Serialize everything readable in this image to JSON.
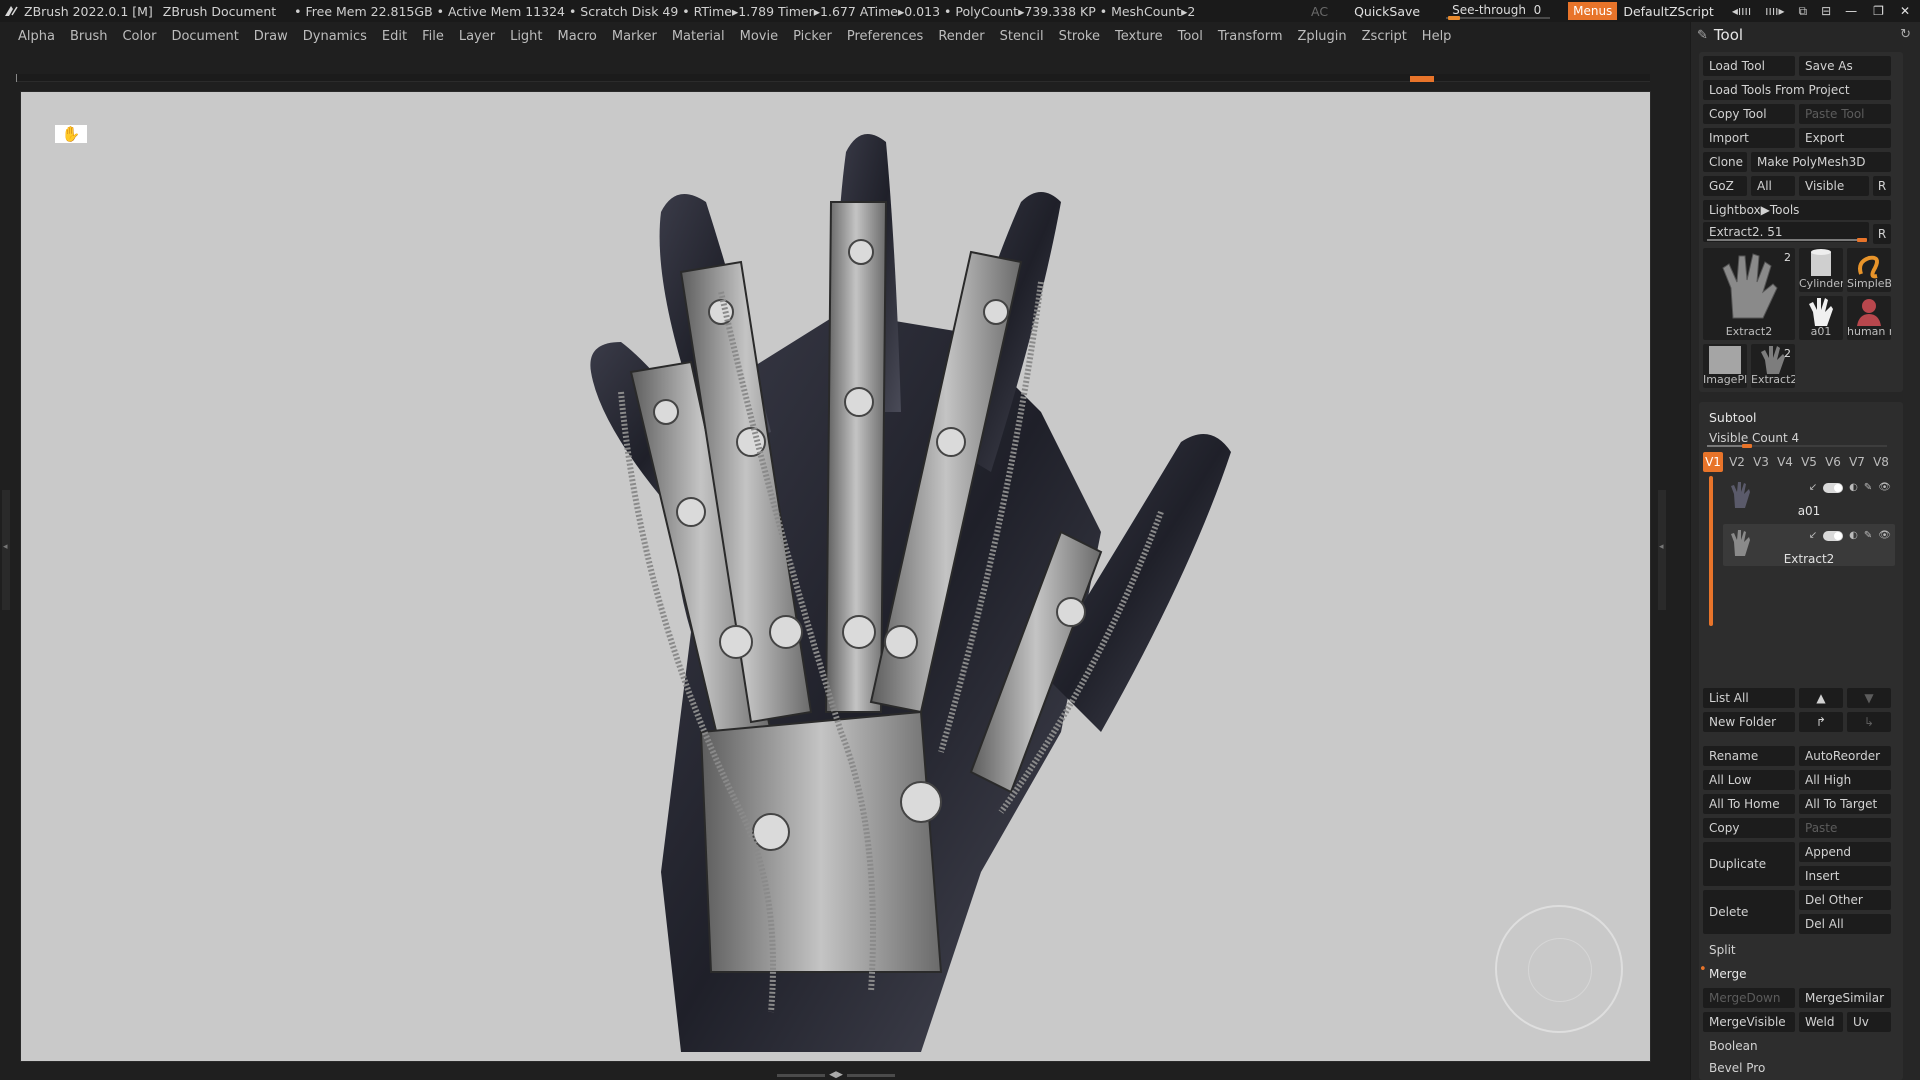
{
  "title_bar": {
    "app": "ZBrush 2022.0.1 [M]",
    "doc": "ZBrush Document",
    "stats": "• Free Mem 22.815GB • Active Mem 11324 • Scratch Disk 49 • RTime▸1.789 Timer▸1.677 ATime▸0.013 • PolyCount▸739.338 KP • MeshCount▸2",
    "ac": "AC",
    "quicksave": "QuickSave",
    "see_through_label": "See-through",
    "see_through_value": "0",
    "menus_label": "Menus",
    "default_zscript": "DefaultZScript"
  },
  "menubar": [
    "Alpha",
    "Brush",
    "Color",
    "Document",
    "Draw",
    "Dynamics",
    "Edit",
    "File",
    "Layer",
    "Light",
    "Macro",
    "Marker",
    "Material",
    "Movie",
    "Picker",
    "Preferences",
    "Render",
    "Stencil",
    "Stroke",
    "Texture",
    "Tool",
    "Transform",
    "Zplugin",
    "Zscript",
    "Help"
  ],
  "tool_panel": {
    "title": "Tool",
    "load_tool": "Load Tool",
    "save_as": "Save As",
    "load_tools_from_project": "Load Tools From Project",
    "copy_tool": "Copy Tool",
    "paste_tool": "Paste Tool",
    "import": "Import",
    "export": "Export",
    "clone": "Clone",
    "make_polymesh3d": "Make PolyMesh3D",
    "goz": "GoZ",
    "all": "All",
    "visible": "Visible",
    "r": "R",
    "lightbox_tools": "Lightbox▶Tools",
    "current_tool_slider": "Extract2. 51",
    "current_tool_fraction": 0.98,
    "thumbs": {
      "extract2_main": "Extract2",
      "extract2_main_count": "2",
      "cylinder": "Cylinder",
      "simpleb": "SimpleB",
      "a01": "a01",
      "human": "human r",
      "imageplane": "ImagePl",
      "extract2_small": "Extract2",
      "extract2_small_count": "2"
    }
  },
  "subtool": {
    "title": "Subtool",
    "visible_count": "Visible Count 4",
    "visible_count_fraction": 0.22,
    "tabs": [
      "V1",
      "V2",
      "V3",
      "V4",
      "V5",
      "V6",
      "V7",
      "V8"
    ],
    "items": [
      {
        "name": "a01"
      },
      {
        "name": "Extract2"
      }
    ],
    "list_all": "List All",
    "new_folder": "New Folder",
    "rename": "Rename",
    "auto_reorder": "AutoReorder",
    "all_low": "All Low",
    "all_high": "All High",
    "all_to_home": "All To Home",
    "all_to_target": "All To Target",
    "copy": "Copy",
    "paste": "Paste",
    "duplicate": "Duplicate",
    "append": "Append",
    "insert": "Insert",
    "delete": "Delete",
    "del_other": "Del Other",
    "del_all": "Del All",
    "split": "Split",
    "merge": "Merge",
    "merge_down": "MergeDown",
    "merge_similar": "MergeSimilar",
    "merge_visible": "MergeVisible",
    "weld": "Weld",
    "uv": "Uv",
    "boolean": "Boolean",
    "bevel_pro": "Bevel Pro"
  },
  "colors": {
    "accent": "#e8742a",
    "canvas_bg": "#c9c9c9",
    "panel_bg": "#262626"
  }
}
